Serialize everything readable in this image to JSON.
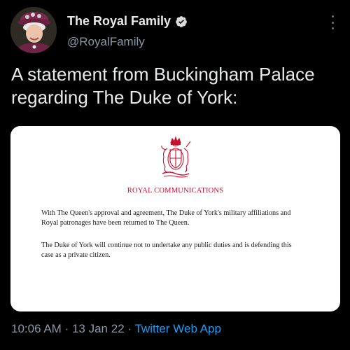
{
  "account": {
    "display_name": "The Royal Family",
    "handle": "@RoyalFamily",
    "verified_icon": "verified-badge-icon",
    "avatar_icon": "profile-avatar"
  },
  "tweet": {
    "text": "A statement from Buckingham Palace regarding The Duke of York:"
  },
  "media": {
    "header": "ROYAL COMMUNICATIONS",
    "paragraph1": "With The Queen's approval and agreement, The Duke of York's military affiliations and Royal patronages have been returned to The Queen.",
    "paragraph2": "The Duke of York will continue not to undertake any public duties and is defending this case as a private citizen.",
    "crest_icon": "royal-crest-icon"
  },
  "meta": {
    "time": "10:06 AM",
    "separator1": "·",
    "date": "13 Jan 22",
    "separator2": "·",
    "source": "Twitter Web App"
  },
  "colors": {
    "background": "#000000",
    "primary_text": "#e7e9ea",
    "secondary_text": "#8b98a5",
    "link": "#1d9bf0",
    "crest_red": "#c8102e"
  }
}
